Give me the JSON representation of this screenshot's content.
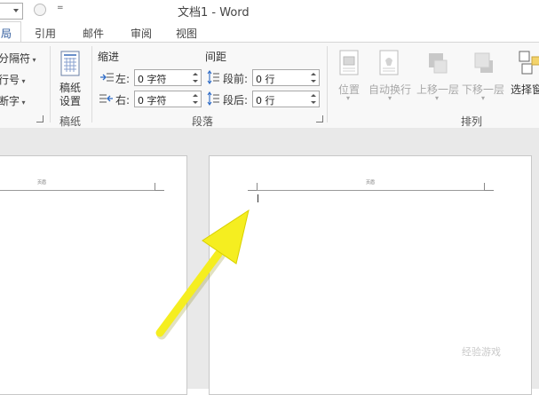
{
  "window": {
    "title": "文档1 - Word",
    "more_symbol": "="
  },
  "tabs": [
    {
      "label": "局"
    },
    {
      "label": "引用"
    },
    {
      "label": "邮件"
    },
    {
      "label": "审阅"
    },
    {
      "label": "视图"
    }
  ],
  "ribbon": {
    "page_setup": {
      "items": [
        "分隔符",
        "行号",
        "断字"
      ]
    },
    "manuscript": {
      "button_line1": "稿纸",
      "button_line2": "设置",
      "group_label": "稿纸"
    },
    "paragraph": {
      "indent_title": "缩进",
      "spacing_title": "间距",
      "left_label": "左:",
      "right_label": "右:",
      "before_label": "段前:",
      "after_label": "段后:",
      "left_value": "0 字符",
      "right_value": "0 字符",
      "before_value": "0 行",
      "after_value": "0 行",
      "group_label": "段落"
    },
    "arrange": {
      "buttons": [
        "位置",
        "自动换行",
        "上移一层",
        "下移一层",
        "选择窗"
      ],
      "group_label": "排列"
    }
  },
  "document": {
    "header_label_left": "页眉",
    "header_label_right": "页眉"
  },
  "watermark": {
    "text": "经验游戏"
  },
  "colors": {
    "arrow": "#f5ee20",
    "accent": "#2b579a"
  }
}
